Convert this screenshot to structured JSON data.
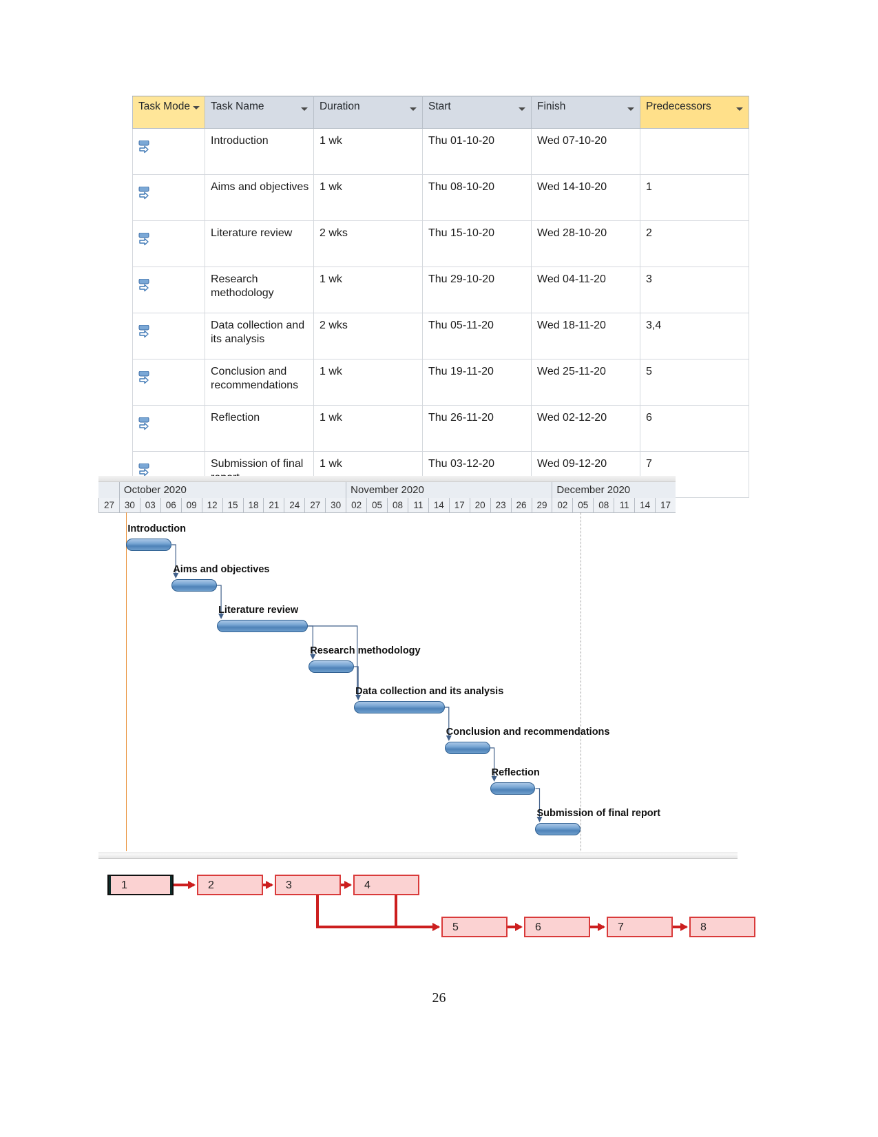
{
  "table": {
    "columns": [
      {
        "key": "task_mode",
        "label": "Task Mode"
      },
      {
        "key": "task_name",
        "label": "Task Name"
      },
      {
        "key": "duration",
        "label": "Duration"
      },
      {
        "key": "start",
        "label": "Start"
      },
      {
        "key": "finish",
        "label": "Finish"
      },
      {
        "key": "predecessors",
        "label": "Predecessors"
      }
    ],
    "filter_icon": "chevron-down-icon",
    "mode_icon": "manually-scheduled-icon",
    "rows": [
      {
        "id": 1,
        "task_name": "Introduction",
        "duration": "1 wk",
        "start": "Thu 01-10-20",
        "finish": "Wed 07-10-20",
        "predecessors": ""
      },
      {
        "id": 2,
        "task_name": "Aims and objectives",
        "duration": "1 wk",
        "start": "Thu 08-10-20",
        "finish": "Wed 14-10-20",
        "predecessors": "1"
      },
      {
        "id": 3,
        "task_name": "Literature review",
        "duration": "2 wks",
        "start": "Thu 15-10-20",
        "finish": "Wed 28-10-20",
        "predecessors": "2"
      },
      {
        "id": 4,
        "task_name": "Research methodology",
        "duration": "1 wk",
        "start": "Thu 29-10-20",
        "finish": "Wed 04-11-20",
        "predecessors": "3"
      },
      {
        "id": 5,
        "task_name": "Data collection and its analysis",
        "duration": "2 wks",
        "start": "Thu 05-11-20",
        "finish": "Wed 18-11-20",
        "predecessors": "3,4"
      },
      {
        "id": 6,
        "task_name": "Conclusion and recommendations",
        "duration": "1 wk",
        "start": "Thu 19-11-20",
        "finish": "Wed 25-11-20",
        "predecessors": "5"
      },
      {
        "id": 7,
        "task_name": "Reflection",
        "duration": "1 wk",
        "start": "Thu 26-11-20",
        "finish": "Wed 02-12-20",
        "predecessors": "6"
      },
      {
        "id": 8,
        "task_name": "Submission of final report",
        "duration": "1 wk",
        "start": "Thu 03-12-20",
        "finish": "Wed 09-12-20",
        "predecessors": "7"
      }
    ]
  },
  "gantt": {
    "months": [
      {
        "label": "October 2020",
        "start_index": 1,
        "span": 11
      },
      {
        "label": "November 2020",
        "start_index": 12,
        "span": 10
      },
      {
        "label": "December 2020",
        "start_index": 22,
        "span": 6
      }
    ],
    "days": [
      "27",
      "30",
      "03",
      "06",
      "09",
      "12",
      "15",
      "18",
      "21",
      "24",
      "27",
      "30",
      "02",
      "05",
      "08",
      "11",
      "14",
      "17",
      "20",
      "23",
      "26",
      "29",
      "02",
      "05",
      "08",
      "11",
      "14",
      "17"
    ],
    "bars": [
      {
        "label": "Introduction",
        "start_day": 1.35,
        "length_days": 2.2
      },
      {
        "label": "Aims and objectives",
        "start_day": 3.55,
        "length_days": 2.2
      },
      {
        "label": "Literature review",
        "start_day": 5.75,
        "length_days": 4.4
      },
      {
        "label": "Research methodology",
        "start_day": 10.2,
        "length_days": 2.2
      },
      {
        "label": "Data collection and its analysis",
        "start_day": 12.4,
        "length_days": 4.4
      },
      {
        "label": "Conclusion and recommendations",
        "start_day": 16.8,
        "length_days": 2.2
      },
      {
        "label": "Reflection",
        "start_day": 19.0,
        "length_days": 2.2
      },
      {
        "label": "Submission of final report",
        "start_day": 21.2,
        "length_days": 2.2
      }
    ],
    "today_line_day": 1.35,
    "status_line_day": 23.4,
    "bar_color": "#4e82b8",
    "today_line_color": "#e8913a"
  },
  "network": {
    "node_color": "#fbd2d2",
    "node_border_color": "#d93a3a",
    "link_color": "#cc1f1f",
    "nodes": [
      {
        "id": "1",
        "label": "1",
        "row": 0,
        "col": 0,
        "selected": true
      },
      {
        "id": "2",
        "label": "2",
        "row": 0,
        "col": 1,
        "selected": false
      },
      {
        "id": "3",
        "label": "3",
        "row": 0,
        "col": 2,
        "selected": false
      },
      {
        "id": "4",
        "label": "4",
        "row": 0,
        "col": 3,
        "selected": false
      },
      {
        "id": "5",
        "label": "5",
        "row": 1,
        "col": 4,
        "selected": false
      },
      {
        "id": "6",
        "label": "6",
        "row": 1,
        "col": 5,
        "selected": false
      },
      {
        "id": "7",
        "label": "7",
        "row": 1,
        "col": 6,
        "selected": false
      },
      {
        "id": "8",
        "label": "8",
        "row": 1,
        "col": 7,
        "selected": false
      }
    ],
    "links": [
      [
        "1",
        "2"
      ],
      [
        "2",
        "3"
      ],
      [
        "3",
        "4"
      ],
      [
        "3",
        "5"
      ],
      [
        "4",
        "5"
      ],
      [
        "5",
        "6"
      ],
      [
        "6",
        "7"
      ],
      [
        "7",
        "8"
      ]
    ]
  },
  "footer": {
    "page_number": "26"
  }
}
